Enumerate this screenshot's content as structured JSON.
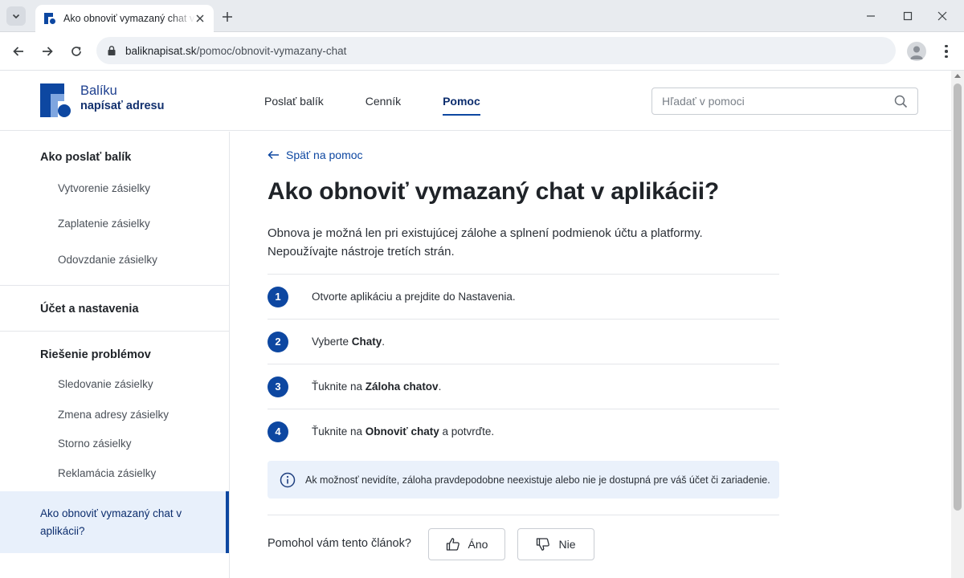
{
  "browser": {
    "tab_title": "Ako obnoviť vymazaný chat v aplikácii",
    "url_domain": "baliknapisat.sk",
    "url_path": "/pomoc/obnovit-vymazany-chat"
  },
  "site": {
    "logo_line1": "Balíku",
    "logo_line2": "napísať adresu",
    "nav": [
      {
        "label": "Poslať balík"
      },
      {
        "label": "Cenník"
      },
      {
        "label": "Pomoc",
        "active": true
      }
    ],
    "search_placeholder": "Hľadať v pomoci"
  },
  "sidebar": {
    "groups": [
      {
        "title": "Ako poslať balík",
        "items": [
          "Vytvorenie zásielky",
          "Zaplatenie zásielky",
          "Odovzdanie zásielky"
        ]
      },
      {
        "title": "Účet a nastavenia",
        "items": []
      },
      {
        "title": "Riešenie problémov",
        "items": [
          "Sledovanie zásielky",
          "Zmena adresy zásielky",
          "Storno zásielky",
          "Reklamácia zásielky"
        ]
      }
    ],
    "active_item": "Ako obnoviť vymazaný chat v aplikácii?"
  },
  "article": {
    "back_label": "Späť na pomoc",
    "title": "Ako obnoviť vymazaný chat v aplikácii?",
    "intro_line1": "Obnova je možná len pri existujúcej zálohe a splnení podmienok účtu a platformy.",
    "intro_line2": "Nepoužívajte nástroje tretích strán.",
    "steps": [
      {
        "num": "1",
        "pre": "Otvorte aplikáciu a prejdite do Nastavenia.",
        "bold": "",
        "post": ""
      },
      {
        "num": "2",
        "pre": "Vyberte ",
        "bold": "Chaty",
        "post": "."
      },
      {
        "num": "3",
        "pre": "Ťuknite na ",
        "bold": "Záloha chatov",
        "post": "."
      },
      {
        "num": "4",
        "pre": "Ťuknite na ",
        "bold": "Obnoviť chaty",
        "post": " a potvrďte."
      }
    ],
    "info": "Ak možnosť nevidíte, záloha pravdepodobne neexistuje alebo nie je dostupná pre váš účet či zariadenie.",
    "feedback_question": "Pomohol vám tento článok?",
    "feedback_yes": "Áno",
    "feedback_no": "Nie"
  },
  "colors": {
    "brand": "#0d47a1",
    "brand_dark": "#13316f",
    "active_bg": "#e8f0fb",
    "info_bg": "#eaf1fb"
  }
}
